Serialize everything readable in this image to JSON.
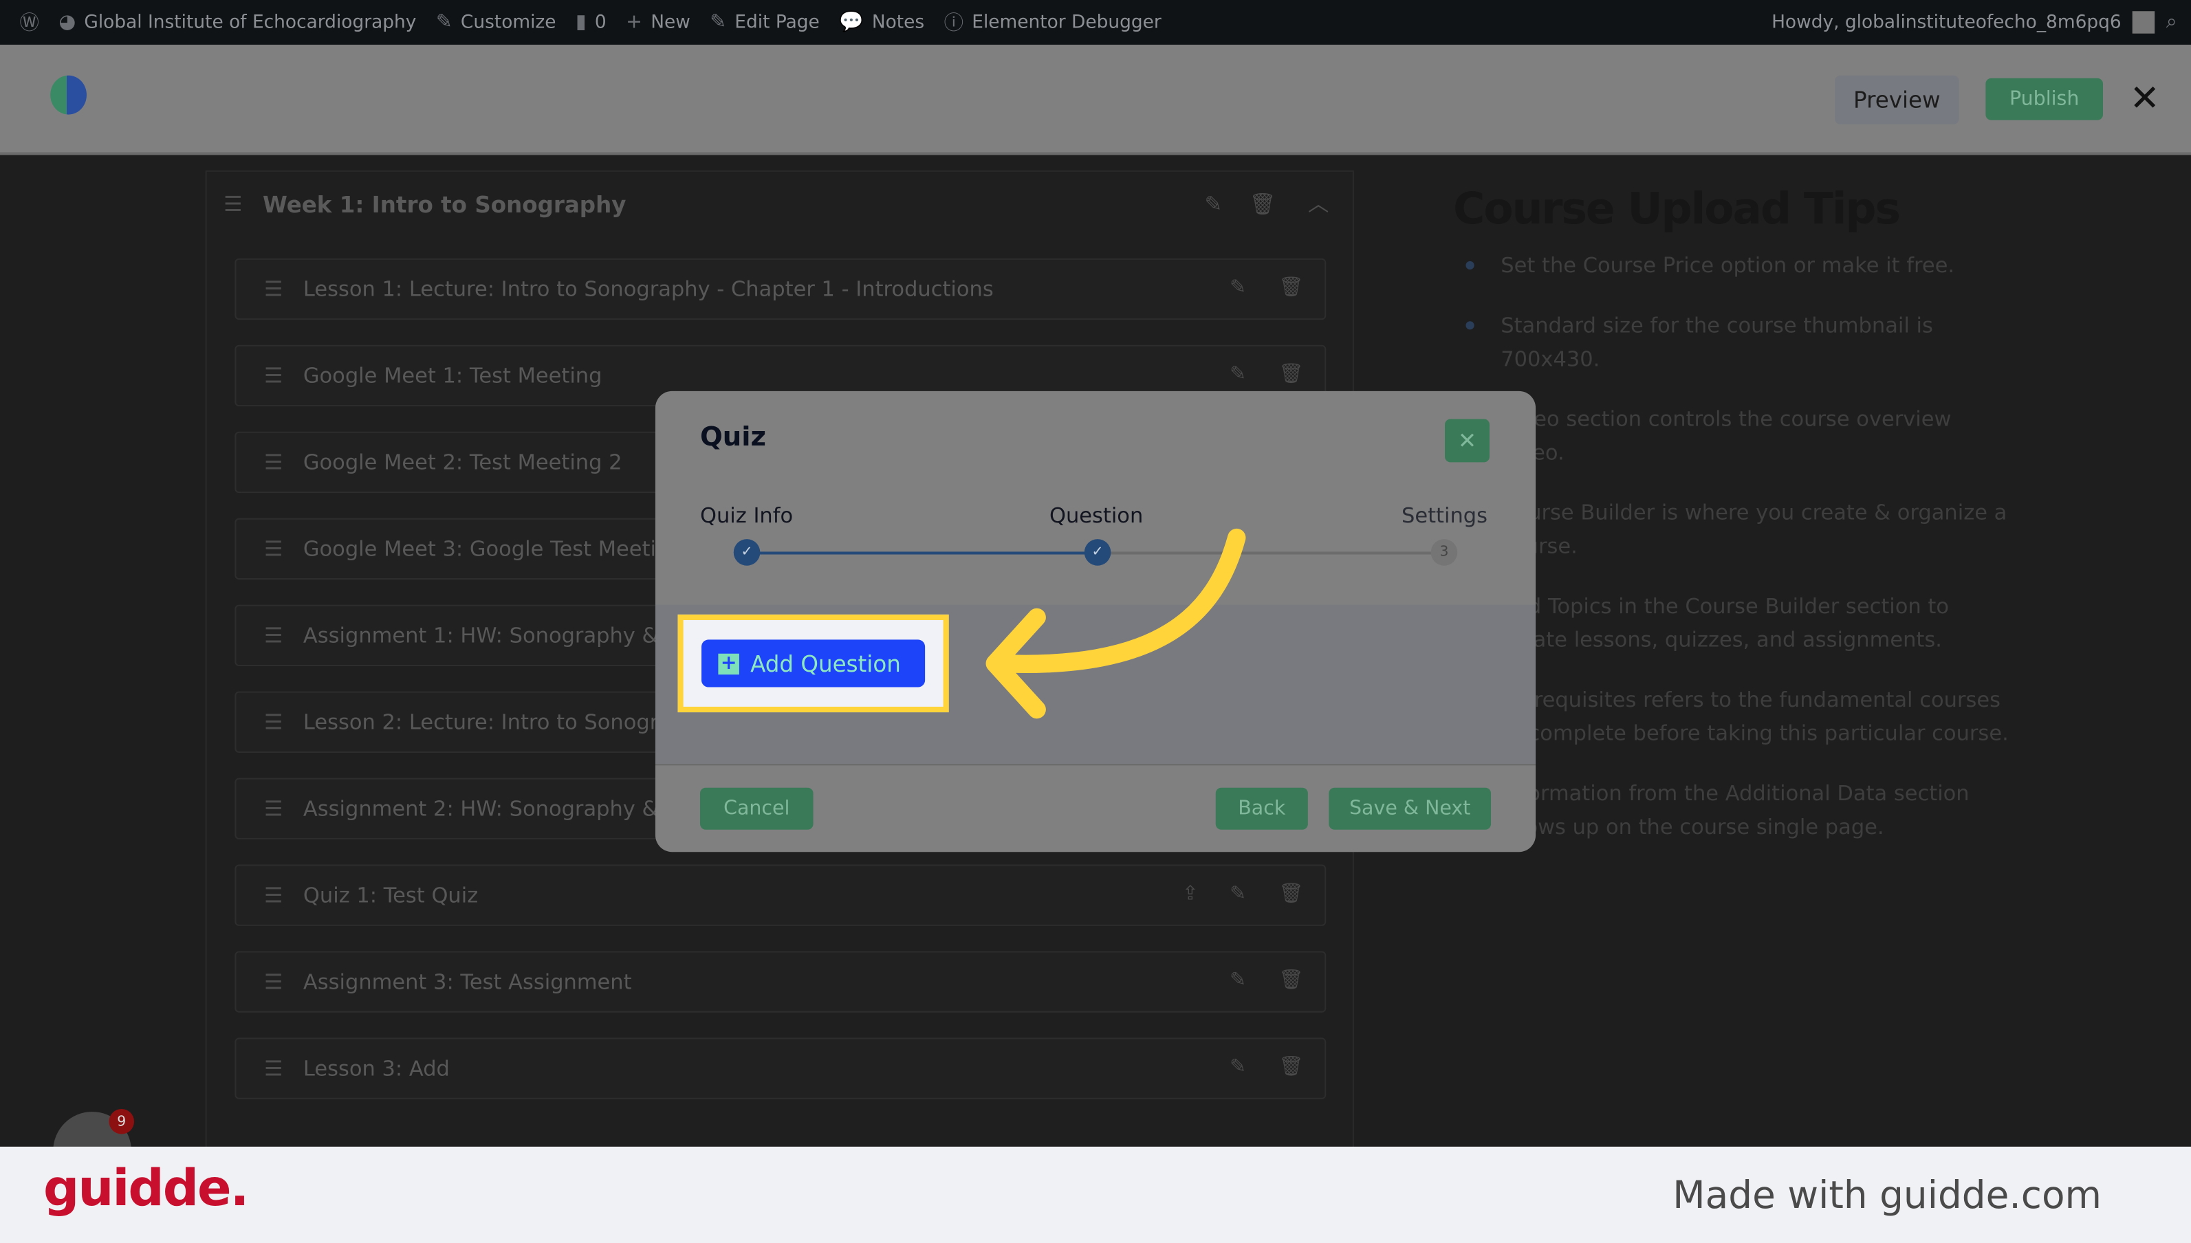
{
  "adminbar": {
    "site": "Global Institute of Echocardiography",
    "customize": "Customize",
    "comments": "0",
    "new": "New",
    "edit_page": "Edit Page",
    "notes": "Notes",
    "debugger": "Elementor Debugger",
    "howdy": "Howdy, globalinstituteofecho_8m6pq6"
  },
  "header": {
    "preview": "Preview",
    "publish": "Publish",
    "close": "✕"
  },
  "topic": {
    "title": "Week 1: Intro to Sonography",
    "items": [
      "Lesson 1: Lecture: Intro to Sonography - Chapter 1 - Introductions",
      "Google Meet 1: Test Meeting",
      "Google Meet 2: Test Meeting 2",
      "Google Meet 3: Google Test Meeting",
      "Assignment 1: HW: Sonography & Instrumentation",
      "Lesson 2: Lecture: Intro to Sonography",
      "Assignment 2: HW: Sonography & Instrumentation",
      "Quiz 1: Test Quiz",
      "Assignment 3: Test Assignment",
      "Lesson 3: Add"
    ]
  },
  "tips": {
    "title": "Course Upload Tips",
    "items": [
      "Set the Course Price option or make it free.",
      "Standard size for the course thumbnail is 700x430.",
      "Video section controls the course overview video.",
      "Course Builder is where you create & organize a course.",
      "Add Topics in the Course Builder section to create lessons, quizzes, and assignments.",
      "Prerequisites refers to the fundamental courses to complete before taking this particular course.",
      "Information from the Additional Data section shows up on the course single page."
    ]
  },
  "modal": {
    "title": "Quiz",
    "close": "✕",
    "steps": [
      {
        "label": "Quiz Info",
        "marker": "✓"
      },
      {
        "label": "Question",
        "marker": "✓"
      },
      {
        "label": "Settings",
        "marker": "3"
      }
    ],
    "add_question": "Add Question",
    "cancel": "Cancel",
    "back": "Back",
    "save_next": "Save & Next"
  },
  "launcher": {
    "badge": "9"
  },
  "footer": {
    "logo": "guidde.",
    "made_with": "Made with guidde.com"
  },
  "colors": {
    "accent": "#1e44fa",
    "highlight": "#ffd43b",
    "green": "#3b7a58",
    "brand_red": "#c8102e"
  }
}
